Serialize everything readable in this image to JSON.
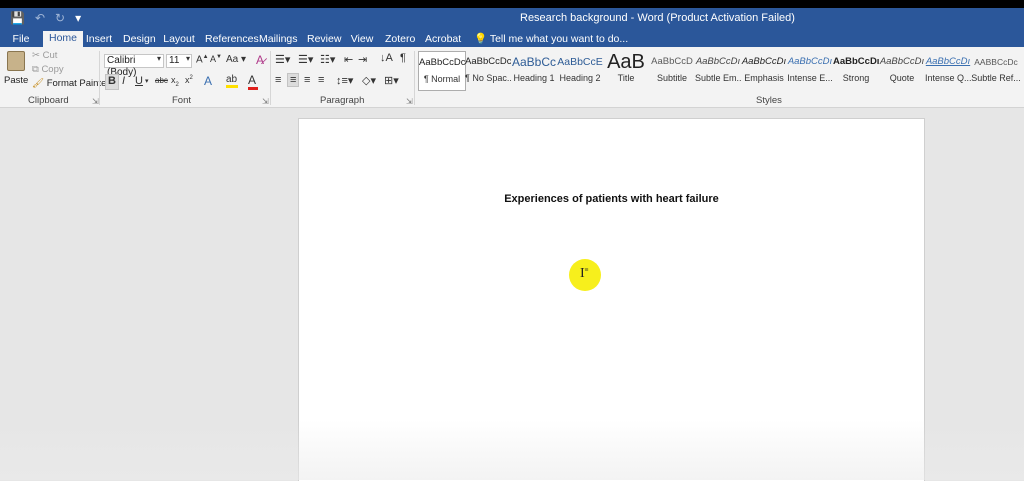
{
  "window": {
    "title": "Research background - Word (Product Activation Failed)"
  },
  "qat": {
    "save_icon": "💾",
    "undo_icon": "↶",
    "redo_icon": "↻",
    "customize_icon": "▾"
  },
  "menu": {
    "tabs": [
      "File",
      "Home",
      "Insert",
      "Design",
      "Layout",
      "References",
      "Mailings",
      "Review",
      "View",
      "Zotero",
      "Acrobat"
    ],
    "active": "Home",
    "tell_me": "Tell me what you want to do..."
  },
  "clipboard": {
    "paste": "Paste",
    "cut": "Cut",
    "copy": "Copy",
    "format_painter": "Format Painter",
    "group": "Clipboard"
  },
  "font": {
    "family": "Calibri (Body)",
    "size": "11",
    "group": "Font"
  },
  "paragraph": {
    "group": "Paragraph"
  },
  "styles": {
    "group": "Styles",
    "items": [
      {
        "preview": "AaBbCcDc",
        "name": "¶ Normal"
      },
      {
        "preview": "AaBbCcDc",
        "name": "¶ No Spac..."
      },
      {
        "preview": "AaBbCc",
        "name": "Heading 1"
      },
      {
        "preview": "AaBbCcE",
        "name": "Heading 2"
      },
      {
        "preview": "AaB",
        "name": "Title"
      },
      {
        "preview": "AaBbCcD",
        "name": "Subtitle"
      },
      {
        "preview": "AaBbCcDı",
        "name": "Subtle Em..."
      },
      {
        "preview": "AaBbCcDı",
        "name": "Emphasis"
      },
      {
        "preview": "AaBbCcDı",
        "name": "Intense E..."
      },
      {
        "preview": "AaBbCcDı",
        "name": "Strong"
      },
      {
        "preview": "AaBbCcDı",
        "name": "Quote"
      },
      {
        "preview": "AaBbCcDı",
        "name": "Intense Q..."
      },
      {
        "preview": "AABBCcDc",
        "name": "Subtle Ref..."
      }
    ]
  },
  "document": {
    "title": "Experiences of patients with heart failure"
  }
}
